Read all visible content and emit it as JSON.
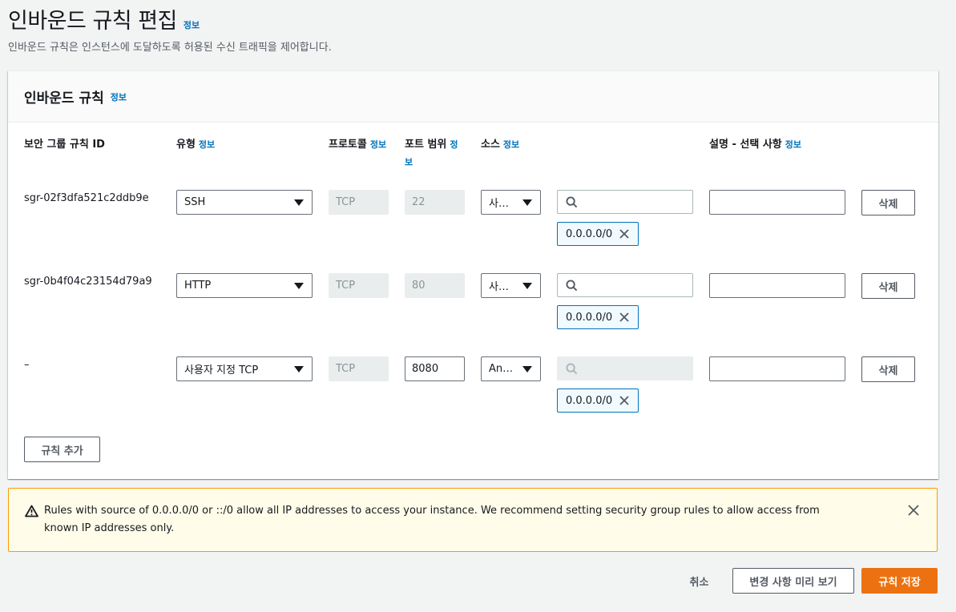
{
  "page": {
    "title": "인바운드 규칙 편집",
    "info": "정보",
    "description": "인바운드 규칙은 인스턴스에 도달하도록 허용된 수신 트래픽을 제어합니다."
  },
  "panel": {
    "title": "인바운드 규칙",
    "info": "정보"
  },
  "columns": {
    "rule_id": "보안 그룹 규칙 ID",
    "type": "유형",
    "type_info": "정보",
    "protocol": "프로토콜",
    "protocol_info": "정보",
    "port_range": "포트 범위",
    "port_range_info_1": "정",
    "port_range_info_2": "보",
    "source": "소스",
    "source_info": "정보",
    "description": "설명 - 선택 사항",
    "description_info": "정보"
  },
  "rules": [
    {
      "id": "sgr-02f3dfa521c2ddb9e",
      "type": "SSH",
      "protocol": "TCP",
      "port": "22",
      "source": "사…",
      "cidr": "0.0.0.0/0",
      "description": "",
      "delete": "삭제"
    },
    {
      "id": "sgr-0b4f04c23154d79a9",
      "type": "HTTP",
      "protocol": "TCP",
      "port": "80",
      "source": "사…",
      "cidr": "0.0.0.0/0",
      "description": "",
      "delete": "삭제"
    },
    {
      "id": "–",
      "type": "사용자 지정 TCP",
      "protocol": "TCP",
      "port": "8080",
      "source": "An…",
      "cidr": "0.0.0.0/0",
      "description": "",
      "delete": "삭제"
    }
  ],
  "add_rule_label": "규칙 추가",
  "warning": {
    "text": "Rules with source of 0.0.0.0/0 or ::/0 allow all IP addresses to access your instance. We recommend setting security group rules to allow access from known IP addresses only."
  },
  "footer": {
    "cancel": "취소",
    "preview": "변경 사항 미리 보기",
    "save": "규칙 저장"
  },
  "colors": {
    "primary": "#ec7211",
    "link": "#0073bb",
    "warning_border": "#ff9900",
    "warning_bg": "#fffce9"
  }
}
